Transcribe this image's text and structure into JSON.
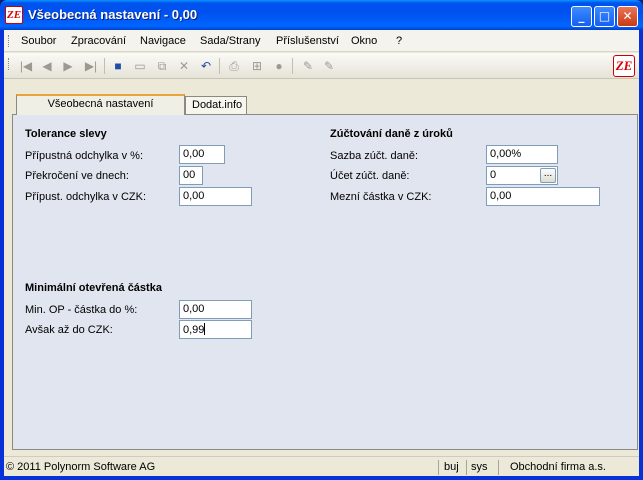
{
  "window": {
    "title": "Všeobecná nastavení - 0,00",
    "icon_label": "ZE",
    "minimize_glyph": "_",
    "maximize_glyph": "□",
    "close_glyph": "✕"
  },
  "menu": {
    "items": [
      "Soubor",
      "Zpracování",
      "Navigace",
      "Sada/Strany",
      "Příslušenství",
      "Okno",
      "?"
    ]
  },
  "toolbar": {
    "icons": [
      {
        "name": "first-record-icon",
        "glyph": "|◀"
      },
      {
        "name": "prev-record-icon",
        "glyph": "◀"
      },
      {
        "name": "next-record-icon",
        "glyph": "▶"
      },
      {
        "name": "last-record-icon",
        "glyph": "▶|"
      },
      {
        "name": "save-icon",
        "glyph": "■"
      },
      {
        "name": "new-icon",
        "glyph": "▭"
      },
      {
        "name": "copy-icon",
        "glyph": "⧉"
      },
      {
        "name": "delete-icon",
        "glyph": "✕"
      },
      {
        "name": "undo-icon",
        "glyph": "↶"
      },
      {
        "name": "print-icon",
        "glyph": "⎙"
      },
      {
        "name": "tree-icon",
        "glyph": "⊞"
      },
      {
        "name": "filter-icon",
        "glyph": "●"
      },
      {
        "name": "edit-icon",
        "glyph": "✎"
      },
      {
        "name": "edit-alt-icon",
        "glyph": "✎"
      }
    ],
    "logo_label": "ZE"
  },
  "tabs": [
    {
      "label": "Všeobecná nastavení",
      "active": true
    },
    {
      "label": "Dodat.info",
      "active": false
    }
  ],
  "form": {
    "tolerance": {
      "title": "Tolerance slevy",
      "fields": [
        {
          "label": "Přípustná odchylka v %:",
          "value": "0,00"
        },
        {
          "label": "Překročení ve dnech:",
          "value": "00"
        },
        {
          "label": "Přípust. odchylka v CZK:",
          "value": "0,00"
        }
      ]
    },
    "tax": {
      "title": "Zúčtování daně z úroků",
      "fields": [
        {
          "label": "Sazba zúčt. daně:",
          "value": "0,00%"
        },
        {
          "label": "Účet zúčt. daně:",
          "value": "0"
        },
        {
          "label": "Mezní částka v CZK:",
          "value": "0,00"
        }
      ],
      "lookup_label": "..."
    },
    "min_open": {
      "title": "Minimální otevřená částka",
      "fields": [
        {
          "label": "Min. OP - částka do %:",
          "value": "0,00"
        },
        {
          "label": "Avšak až do CZK:",
          "value": "0,99"
        }
      ]
    }
  },
  "status": {
    "copyright": "© 2011 Polynorm Software AG",
    "mode": "buj",
    "user": "sys",
    "company": "Obchodní firma a.s."
  },
  "colors": {
    "titlebar": "#0053ee",
    "panel": "#e1e5ef",
    "active_tab_accent": "#e8a33c",
    "field_border": "#7f9db9"
  }
}
